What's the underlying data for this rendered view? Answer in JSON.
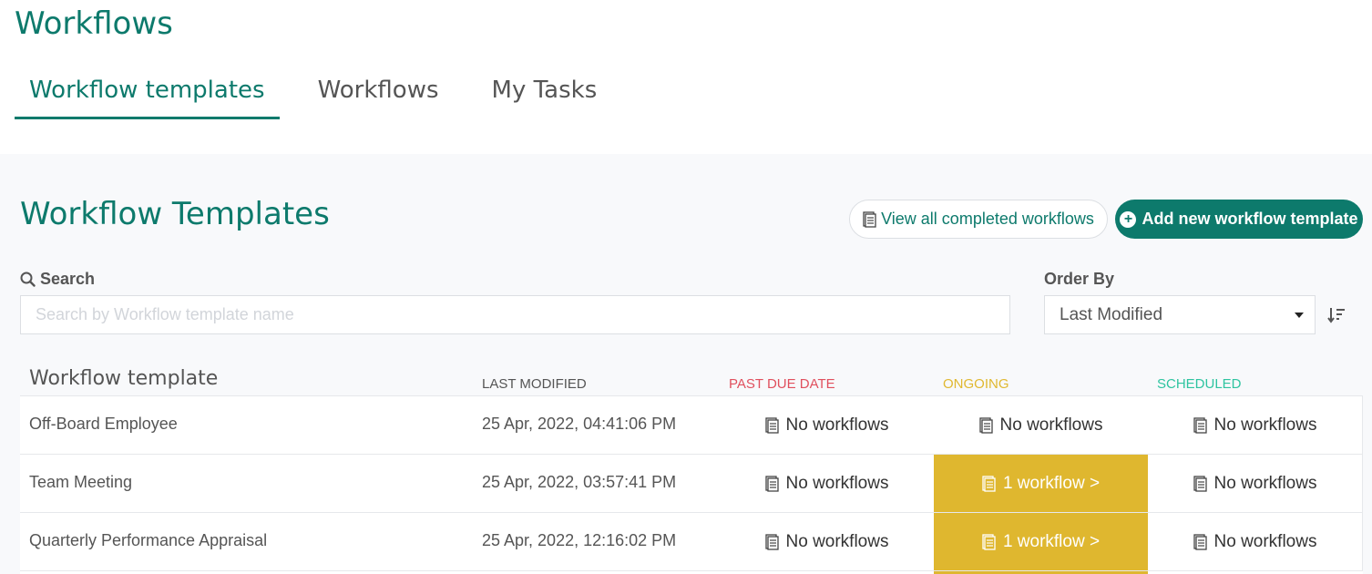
{
  "app_title": "Workflows",
  "tabs": [
    {
      "label": "Workflow templates",
      "active": true
    },
    {
      "label": "Workflows",
      "active": false
    },
    {
      "label": "My Tasks",
      "active": false
    }
  ],
  "section_title": "Workflow Templates",
  "buttons": {
    "view_completed": "View all completed workflows",
    "add_new": "Add new workflow template"
  },
  "search": {
    "label": "Search",
    "placeholder": "Search by Workflow template name",
    "value": ""
  },
  "order": {
    "label": "Order By",
    "selected": "Last Modified"
  },
  "table": {
    "headers": {
      "name": "Workflow template",
      "last_modified": "LAST MODIFIED",
      "past_due": "PAST DUE DATE",
      "ongoing": "ONGOING",
      "scheduled": "SCHEDULED"
    },
    "rows": [
      {
        "name": "Off-Board Employee",
        "last_modified": "25 Apr, 2022, 04:41:06 PM",
        "past_due": "No workflows",
        "ongoing": "No workflows",
        "scheduled": "No workflows"
      },
      {
        "name": "Team Meeting",
        "last_modified": "25 Apr, 2022, 03:57:41 PM",
        "past_due": "No workflows",
        "ongoing": "1 workflow >",
        "scheduled": "No workflows"
      },
      {
        "name": "Quarterly Performance Appraisal",
        "last_modified": "25 Apr, 2022, 12:16:02 PM",
        "past_due": "No workflows",
        "ongoing": "1 workflow >",
        "scheduled": "No workflows"
      }
    ]
  },
  "colors": {
    "brand": "#0d7a6c",
    "past_due": "#e0505e",
    "ongoing": "#e0b830",
    "ongoing_fill": "#dfb72f",
    "scheduled": "#2ec4a0"
  }
}
